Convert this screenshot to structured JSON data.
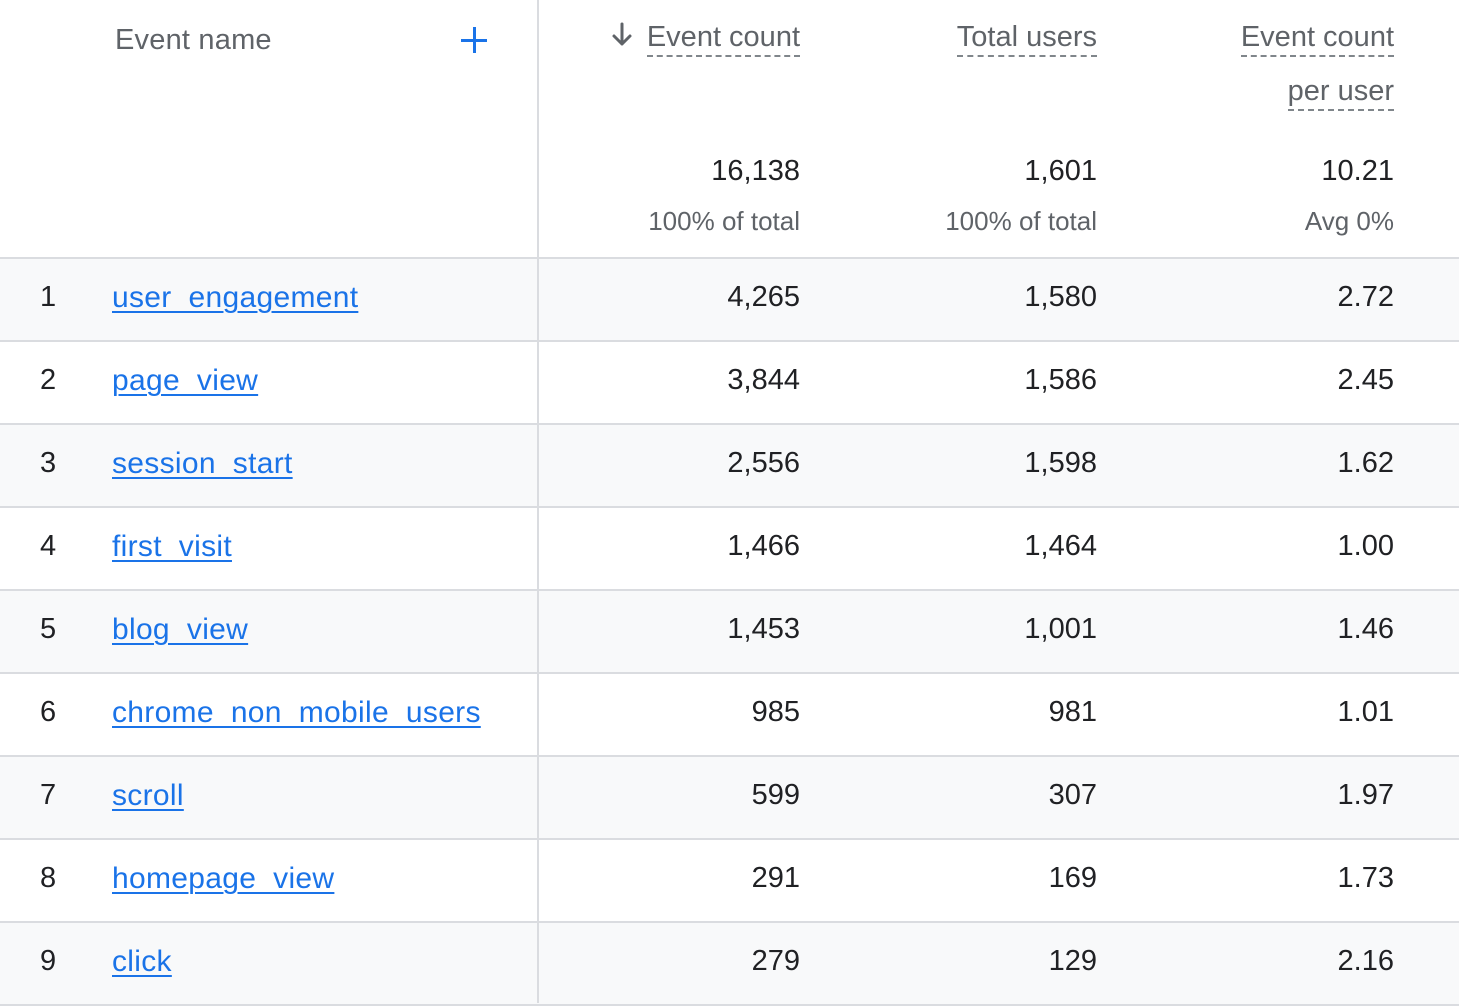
{
  "table": {
    "dimension_header": "Event name",
    "add_dimension_icon": "plus-icon",
    "sort_icon": "arrow-down-icon",
    "metrics": [
      {
        "label_lines": [
          "Event count"
        ],
        "sorted": true,
        "sort_direction": "descending",
        "total": "16,138",
        "total_sub": "100% of total"
      },
      {
        "label_lines": [
          "Total users"
        ],
        "sorted": false,
        "total": "1,601",
        "total_sub": "100% of total"
      },
      {
        "label_lines": [
          "Event count",
          "per user"
        ],
        "sorted": false,
        "total": "10.21",
        "total_sub": "Avg 0%"
      }
    ],
    "rows": [
      {
        "index": "1",
        "name": "user_engagement",
        "event_count": "4,265",
        "total_users": "1,580",
        "per_user": "2.72"
      },
      {
        "index": "2",
        "name": "page_view",
        "event_count": "3,844",
        "total_users": "1,586",
        "per_user": "2.45"
      },
      {
        "index": "3",
        "name": "session_start",
        "event_count": "2,556",
        "total_users": "1,598",
        "per_user": "1.62"
      },
      {
        "index": "4",
        "name": "first_visit",
        "event_count": "1,466",
        "total_users": "1,464",
        "per_user": "1.00"
      },
      {
        "index": "5",
        "name": "blog_view",
        "event_count": "1,453",
        "total_users": "1,001",
        "per_user": "1.46"
      },
      {
        "index": "6",
        "name": "chrome_non_mobile_users",
        "event_count": "985",
        "total_users": "981",
        "per_user": "1.01"
      },
      {
        "index": "7",
        "name": "scroll",
        "event_count": "599",
        "total_users": "307",
        "per_user": "1.97"
      },
      {
        "index": "8",
        "name": "homepage_view",
        "event_count": "291",
        "total_users": "169",
        "per_user": "1.73"
      },
      {
        "index": "9",
        "name": "click",
        "event_count": "279",
        "total_users": "129",
        "per_user": "2.16"
      }
    ]
  },
  "colors": {
    "link": "#1a73e8",
    "header_text": "#5f6368",
    "body_text": "#202124",
    "border": "#dadce0",
    "shaded_row": "#f8f9fa"
  }
}
